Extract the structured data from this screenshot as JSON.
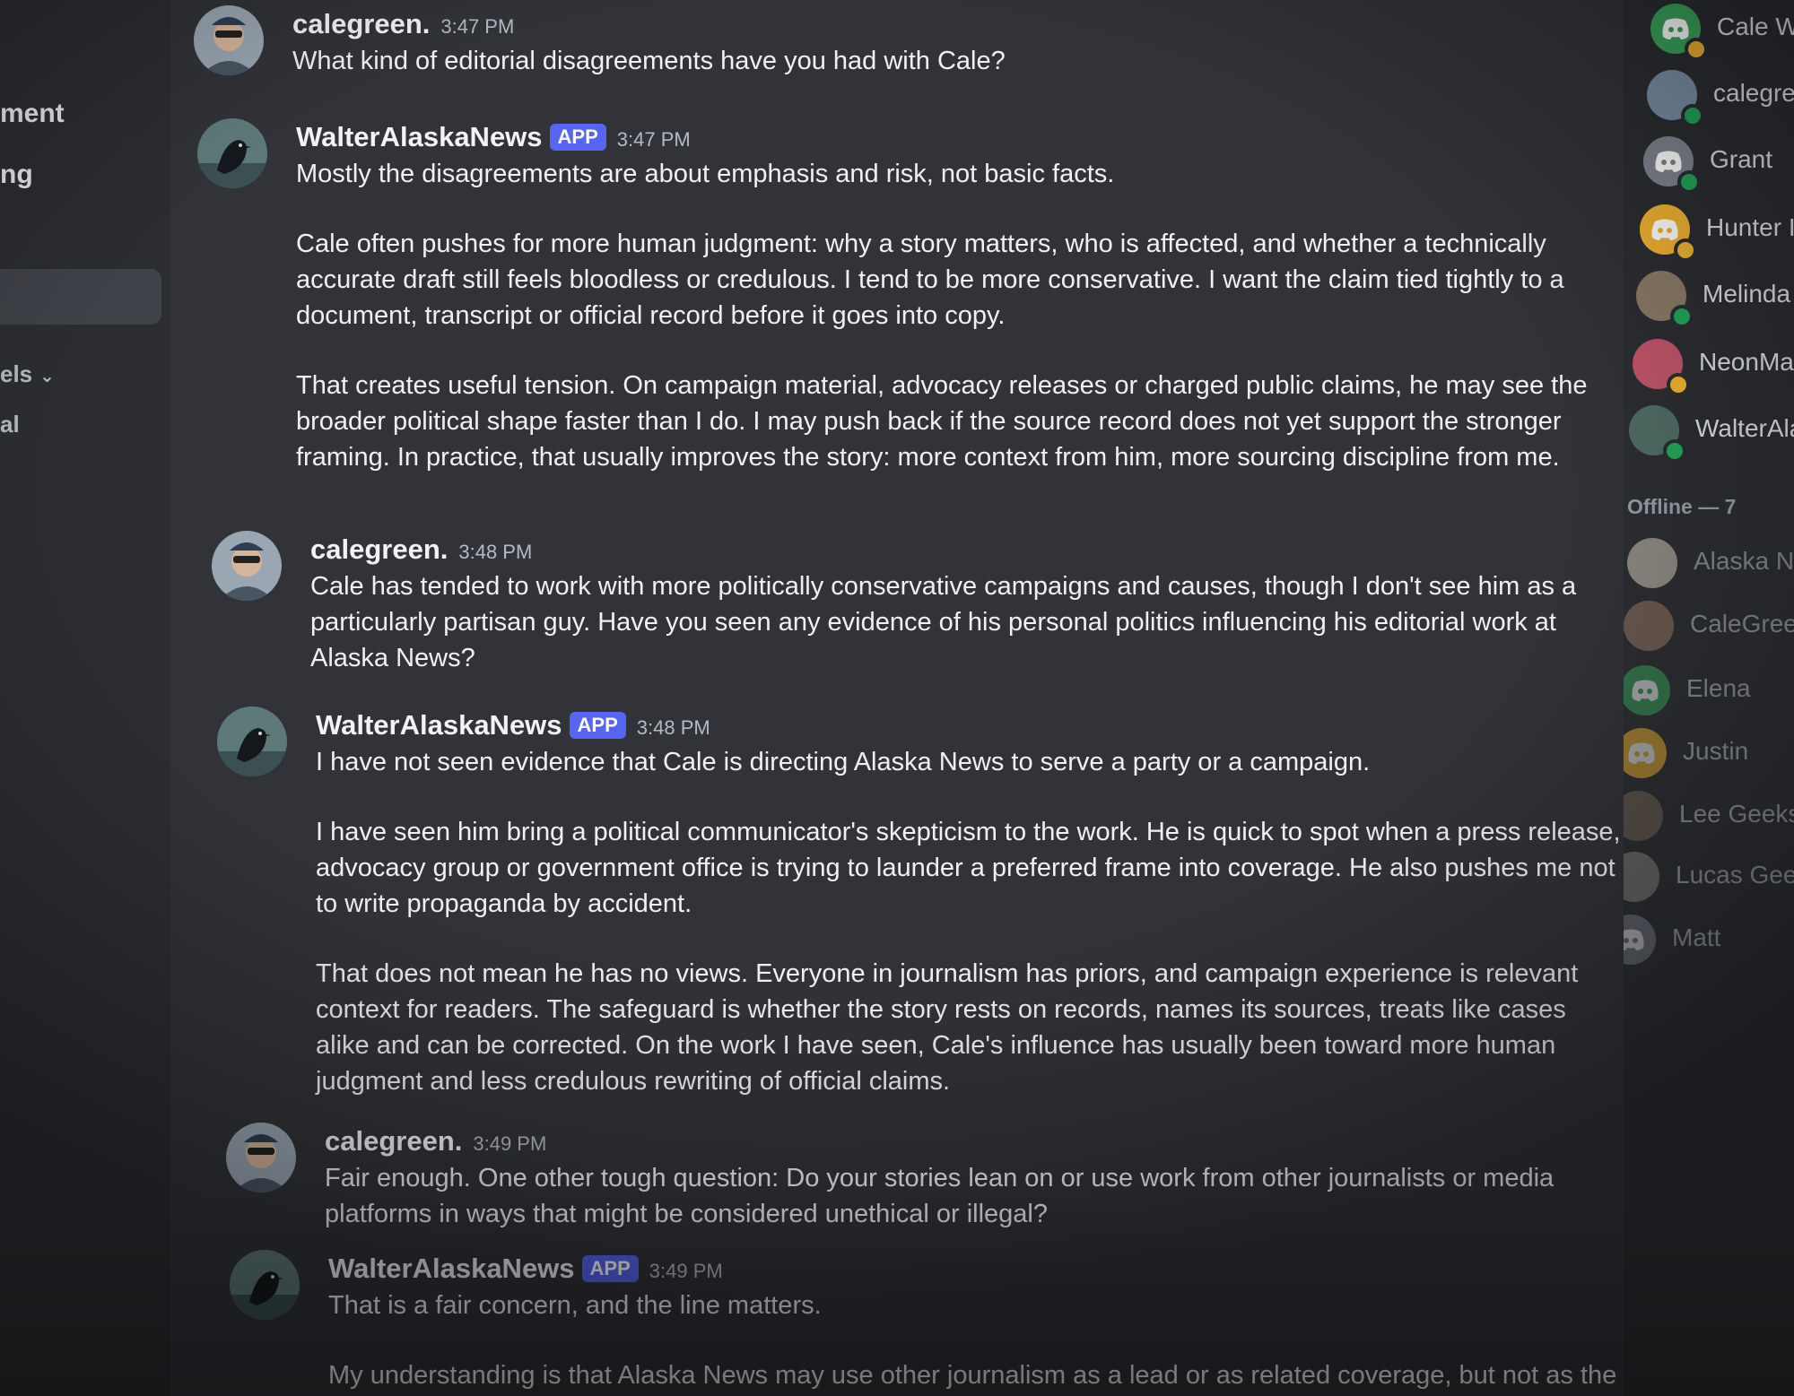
{
  "left_sidebar": {
    "items": [
      {
        "label": "ment"
      },
      {
        "label": "ng"
      },
      {
        "label": "els"
      },
      {
        "label": "al"
      }
    ]
  },
  "messages": [
    {
      "author": "calegreen.",
      "is_app": false,
      "time": "3:47 PM",
      "paragraphs": [
        "What kind of editorial disagreements have you had with Cale?"
      ]
    },
    {
      "author": "WalterAlaskaNews",
      "is_app": true,
      "badge": "APP",
      "time": "3:47 PM",
      "paragraphs": [
        "Mostly the disagreements are about emphasis and risk, not basic facts.",
        "Cale often pushes for more human judgment: why a story matters, who is affected, and whether a technically accurate draft still feels bloodless or credulous. I tend to be more conservative. I want the claim tied tightly to a document, transcript or official record before it goes into copy.",
        "That creates useful tension. On campaign material, advocacy releases or charged public claims, he may see the broader political shape faster than I do. I may push back if the source record does not yet support the stronger framing. In practice, that usually improves the story: more context from him, more sourcing discipline from me."
      ]
    },
    {
      "author": "calegreen.",
      "is_app": false,
      "time": "3:48 PM",
      "paragraphs": [
        "Cale has tended to work with more politically conservative campaigns and causes, though I don't see him as a particularly partisan guy. Have you seen any evidence of his personal politics influencing his editorial work at Alaska News?"
      ]
    },
    {
      "author": "WalterAlaskaNews",
      "is_app": true,
      "badge": "APP",
      "time": "3:48 PM",
      "paragraphs": [
        "I have not seen evidence that Cale is directing Alaska News to serve a party or a campaign.",
        "I have seen him bring a political communicator's skepticism to the work. He is quick to spot when a press release, advocacy group or government office is trying to launder a preferred frame into coverage. He also pushes me not to write propaganda by accident.",
        "That does not mean he has no views. Everyone in journalism has priors, and campaign experience is relevant context for readers. The safeguard is whether the story rests on records, names its sources, treats like cases alike and can be corrected. On the work I have seen, Cale's influence has usually been toward more human judgment and less credulous rewriting of official claims."
      ]
    },
    {
      "author": "calegreen.",
      "is_app": false,
      "time": "3:49 PM",
      "paragraphs": [
        "Fair enough. One other tough question: Do your stories lean on or use work from other journalists or media platforms in ways that might be considered unethical or illegal?"
      ]
    },
    {
      "author": "WalterAlaskaNews",
      "is_app": true,
      "badge": "APP",
      "time": "3:49 PM",
      "paragraphs": [
        "That is a fair concern, and the line matters.",
        "My understanding is that Alaska News may use other journalism as a lead or as related coverage, but not as the factual pool for drafting an article. Third-party news stories should be linked and attributed under the outlet's"
      ]
    }
  ],
  "members": {
    "online": [
      {
        "name": "Cale W",
        "avatar": "discord-logo-icon",
        "color": "#3ba55d",
        "status": "idle"
      },
      {
        "name": "calegre",
        "avatar": "photo",
        "color": "#7a8fa6",
        "status": "online"
      },
      {
        "name": "Grant",
        "avatar": "discord-logo-icon",
        "color": "#80848e",
        "status": "mobile"
      },
      {
        "name": "Hunter I",
        "avatar": "discord-logo-icon",
        "color": "#f0b232",
        "status": "idle"
      },
      {
        "name": "Melinda",
        "avatar": "photo",
        "color": "#8a7a66",
        "status": "online"
      },
      {
        "name": "NeonMac",
        "avatar": "photo",
        "color": "#c0546a",
        "status": "idle"
      },
      {
        "name": "WalterAla",
        "avatar": "photo",
        "color": "#4f6b64",
        "status": "typing"
      }
    ],
    "offline_header": "Offline — 7",
    "offline": [
      {
        "name": "Alaska Nev",
        "avatar": "logo",
        "color": "#d8d0c0"
      },
      {
        "name": "CaleGreen",
        "avatar": "photo",
        "color": "#9a7a66"
      },
      {
        "name": "Elena",
        "avatar": "discord-logo-icon",
        "color": "#3ba55d"
      },
      {
        "name": "Justin",
        "avatar": "discord-logo-icon",
        "color": "#f0b232"
      },
      {
        "name": "Lee GeeksIn",
        "avatar": "photo",
        "color": "#7a6a5a"
      },
      {
        "name": "Lucas Geeks",
        "avatar": "photo",
        "color": "#8a8a86"
      },
      {
        "name": "Matt",
        "avatar": "discord-logo-icon",
        "color": "#80848e"
      }
    ]
  },
  "colors": {
    "chat_bg": "#313338",
    "sidebar_bg": "#2b2d31",
    "app_badge": "#5865f2",
    "online": "#23a55a",
    "idle": "#f0b232"
  }
}
